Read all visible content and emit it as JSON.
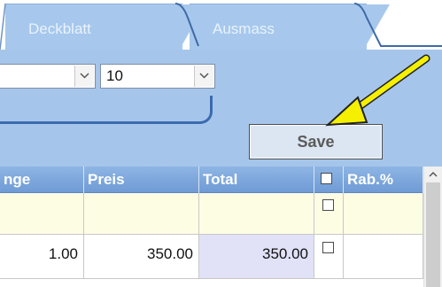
{
  "tabs": [
    {
      "label": "Deckblatt"
    },
    {
      "label": "Ausmass"
    }
  ],
  "filters": {
    "first_select_value": "",
    "second_select_value": "10"
  },
  "toolbar": {
    "save_label": "Save"
  },
  "grid": {
    "headers": [
      "nge",
      "Preis",
      "Total",
      "",
      "Rab.%"
    ],
    "rows": [
      {
        "menge": "",
        "preis": "",
        "total": "",
        "checked": false,
        "rab": ""
      },
      {
        "menge": "1.00",
        "preis": "350.00",
        "total": "350.00",
        "checked": false,
        "rab": ""
      }
    ]
  },
  "colors": {
    "panel": "#a6c5ea",
    "header": "#7aa5da",
    "arrow": "#f4f000",
    "total_cell": "#e1e2f8",
    "empty_row": "#fdfde4"
  },
  "icons": [
    "chevron-down-icon",
    "arrow-pointer-icon",
    "scroll-up-icon",
    "checkbox-icon"
  ]
}
